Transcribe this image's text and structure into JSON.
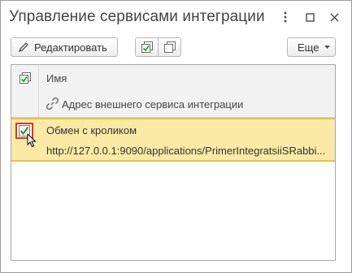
{
  "window": {
    "title": "Управление сервисами интеграции"
  },
  "toolbar": {
    "edit_label": "Редактировать",
    "more_label": "Еще",
    "check_all_icon": "check-all-icon",
    "uncheck_all_icon": "uncheck-all-icon"
  },
  "table": {
    "header": {
      "name": "Имя",
      "address": "Адрес внешнего сервиса интеграции"
    },
    "rows": [
      {
        "checked": true,
        "name": "Обмен с кроликом",
        "address": "http://127.0.0.1:9090/applications/PrimerIntegratsiiSRabbi..."
      }
    ]
  },
  "colors": {
    "selected_row": "#fbeaa5",
    "selected_row_border": "#e5c24a",
    "checkbox_focus": "#e03030",
    "check_green": "#2f9a2f"
  }
}
